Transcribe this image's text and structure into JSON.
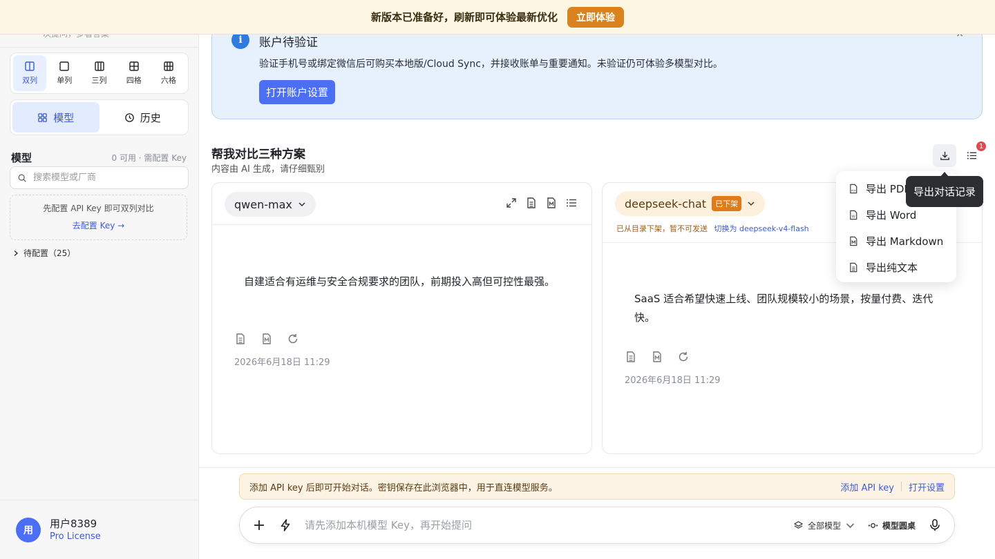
{
  "banner": {
    "text": "新版本已准备好，刷新即可体验最新优化",
    "button": "立即体验"
  },
  "sidebar": {
    "clipped_text": "次提问，多看答案",
    "layouts": [
      {
        "label": "双列",
        "icon": "two-column-icon",
        "active": true
      },
      {
        "label": "单列",
        "icon": "single-column-icon",
        "active": false
      },
      {
        "label": "三列",
        "icon": "three-column-icon",
        "active": false
      },
      {
        "label": "四格",
        "icon": "four-grid-icon",
        "active": false
      },
      {
        "label": "六格",
        "icon": "six-grid-icon",
        "active": false
      }
    ],
    "modes": [
      {
        "label": "模型",
        "icon": "grid-icon",
        "active": true
      },
      {
        "label": "历史",
        "icon": "clock-icon",
        "active": false
      }
    ],
    "models_title": "模型",
    "models_meta": "0 可用 · 需配置 Key",
    "search_placeholder": "搜索模型或厂商",
    "apikey_hint": "先配置 API Key 即可双列对比",
    "apikey_link": "去配置 Key →",
    "pending": "待配置（25）",
    "user": {
      "avatar": "用",
      "name": "用户8389",
      "license": "Pro License"
    }
  },
  "verify": {
    "icon": "i",
    "title": "账户待验证",
    "desc": "验证手机号或绑定微信后可购买本地版/Cloud Sync，并接收账单与重要通知。未验证仍可体验多模型对比。",
    "button": "打开账户设置",
    "close": "×"
  },
  "conversation": {
    "title": "帮我对比三种方案",
    "subtitle": "内容由 AI 生成，请仔细甄别",
    "badge": "1"
  },
  "panels": [
    {
      "model": "qwen-max",
      "message": "自建适合有运维与安全合规要求的团队，前期投入高但可控性最强。",
      "time": "2026年6月18日 11:29"
    },
    {
      "model": "deepseek-chat",
      "delisted_tag": "已下架",
      "delisted_note": "已从目录下架，暂不可发送",
      "switch_link": "切换为 deepseek-v4-flash",
      "message": "SaaS 适合希望快速上线、团队规模较小的场景，按量付费、迭代快。",
      "time": "2026年6月18日 11:29"
    }
  ],
  "export_menu": {
    "tooltip": "导出对话记录",
    "items": [
      "导出 PDF",
      "导出 Word",
      "导出 Markdown",
      "导出纯文本"
    ]
  },
  "notice": {
    "text": "添加 API key 后即可开始对话。密钥保存在此浏览器中，用于直连模型服务。",
    "add_key": "添加 API key",
    "open_settings": "打开设置"
  },
  "composer": {
    "placeholder": "请先添加本机模型 Key，再开始提问",
    "all_models": "全部模型",
    "roundtable": "模型圆桌"
  }
}
